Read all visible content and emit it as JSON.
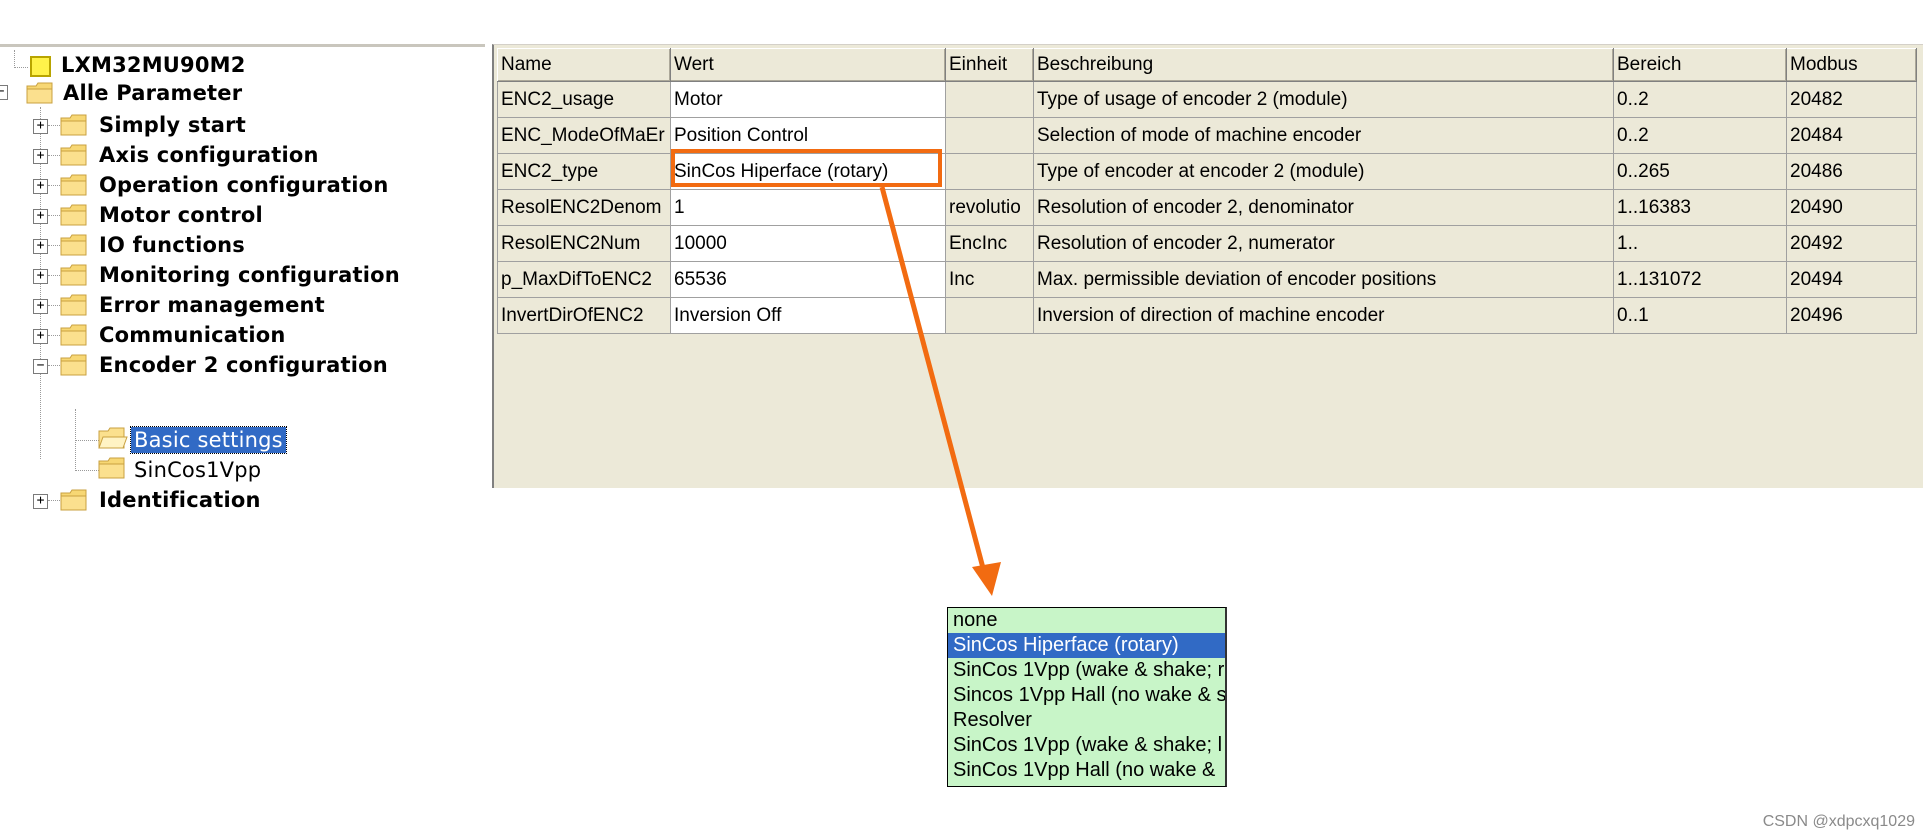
{
  "tree": {
    "root": "LXM32MU90M2",
    "all_params": "Alle Parameter",
    "groups": [
      "Simply start",
      "Axis configuration",
      "Operation configuration",
      "Motor control",
      "IO functions",
      "Monitoring configuration",
      "Error management",
      "Communication",
      "Encoder 2 configuration"
    ],
    "children": [
      "Basic settings",
      "SinCos1Vpp"
    ],
    "last_group": "Identification",
    "selected": "Basic settings"
  },
  "grid": {
    "headers": [
      "Name",
      "Wert",
      "Einheit",
      "Beschreibung",
      "Bereich",
      "Modbus"
    ],
    "rows": [
      [
        "ENC2_usage",
        "Motor",
        "",
        "Type of usage of encoder 2 (module)",
        "0..2",
        "20482"
      ],
      [
        "ENC_ModeOfMaEr",
        "Position Control",
        "",
        "Selection of mode of machine encoder",
        "0..2",
        "20484"
      ],
      [
        "ENC2_type",
        "SinCos Hiperface (rotary)",
        "",
        "Type of encoder at encoder 2 (module)",
        "0..265",
        "20486"
      ],
      [
        "ResolENC2Denom",
        "1",
        "revolutio",
        "Resolution of encoder 2, denominator",
        "1..16383",
        "20490"
      ],
      [
        "ResolENC2Num",
        "10000",
        "EncInc",
        "Resolution of encoder 2, numerator",
        "1..",
        "20492"
      ],
      [
        "p_MaxDifToENC2",
        "65536",
        "Inc",
        "Max. permissible deviation of encoder positions",
        "1..131072",
        "20494"
      ],
      [
        "InvertDirOfENC2",
        "Inversion Off",
        "",
        "Inversion of direction of machine encoder",
        "0..1",
        "20496"
      ]
    ]
  },
  "dropdown": {
    "options": [
      "none",
      "SinCos Hiperface (rotary)",
      "SinCos 1Vpp (wake & shake; r",
      "Sincos 1Vpp Hall (no wake & s",
      "Resolver",
      "SinCos 1Vpp (wake & shake; l",
      "SinCos 1Vpp Hall (no wake &"
    ],
    "selected_index": 1
  },
  "colors": {
    "highlight": "#f26b11",
    "selection": "#316ac5",
    "dropdown_bg": "#c8f5c8",
    "panel_bg": "#ece9d8"
  },
  "watermark": "CSDN @xdpcxq1029"
}
